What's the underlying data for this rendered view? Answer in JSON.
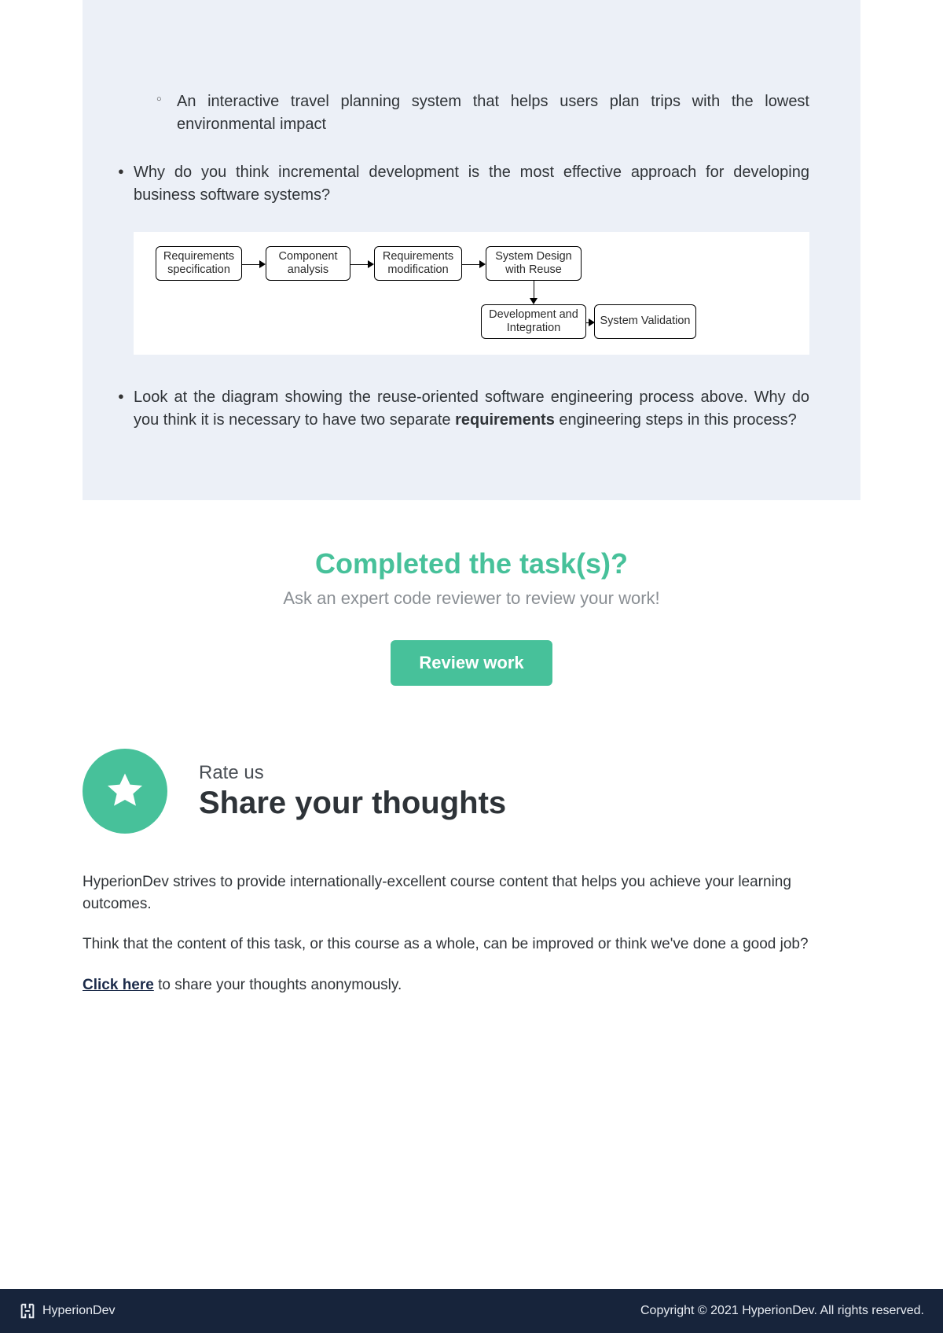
{
  "panel": {
    "sub_item": "An interactive travel planning system that helps users plan trips with the lowest environmental impact",
    "q2": "Why do you think incremental development is the most effective approach for developing business software systems?",
    "q3_pre": "Look at the diagram showing the reuse-oriented software engineering process above. Why do you think it is necessary to have two separate ",
    "q3_bold": "requirements",
    "q3_post": " engineering steps in this process?"
  },
  "diagram": {
    "b1": "Requirements specification",
    "b2": "Component analysis",
    "b3": "Requirements modification",
    "b4": "System Design with Reuse",
    "b5": "Development and Integration",
    "b6": "System Validation"
  },
  "completed": {
    "title": "Completed the task(s)?",
    "subtitle": "Ask an expert code reviewer to review your work!",
    "button": "Review work"
  },
  "rate": {
    "small": "Rate us",
    "big": "Share your thoughts",
    "p1": "HyperionDev strives to provide internationally-excellent course content that helps you achieve your learning outcomes.",
    "p2": "Think that the content of this task, or this course as a whole, can be improved or think we've done a good job?",
    "link": "Click here",
    "p3_rest": " to share your thoughts anonymously."
  },
  "footer": {
    "brand": "HyperionDev",
    "copyright": "Copyright © 2021 HyperionDev. All rights reserved."
  }
}
